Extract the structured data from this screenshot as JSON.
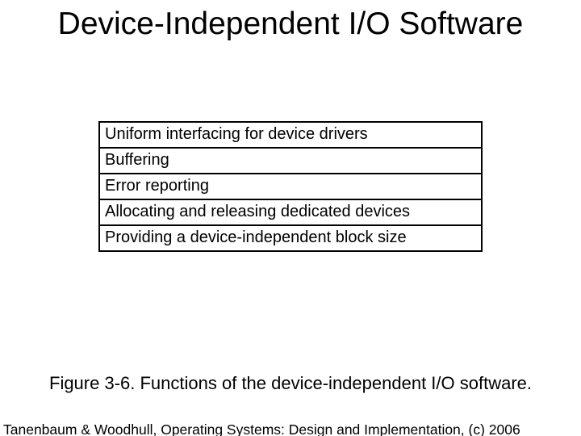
{
  "title": "Device-Independent I/O Software",
  "rows": [
    "Uniform interfacing for device drivers",
    "Buffering",
    "Error reporting",
    "Allocating and releasing dedicated devices",
    "Providing a device-independent block size"
  ],
  "caption": "Figure 3-6. Functions of the device-independent I/O software.",
  "footer": "Tanenbaum & Woodhull, Operating Systems: Design and Implementation, (c) 2006"
}
